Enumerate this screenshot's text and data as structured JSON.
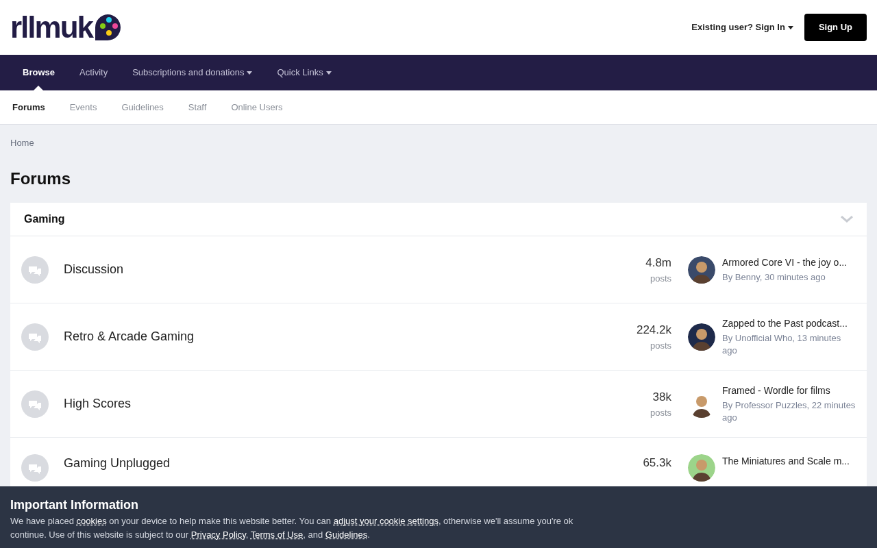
{
  "header": {
    "logo": "rllmuk",
    "sign_in": "Existing user? Sign In",
    "sign_up": "Sign Up"
  },
  "nav": [
    {
      "label": "Browse",
      "selected": true,
      "dropdown": false
    },
    {
      "label": "Activity",
      "selected": false,
      "dropdown": false
    },
    {
      "label": "Subscriptions and donations",
      "selected": false,
      "dropdown": true
    },
    {
      "label": "Quick Links",
      "selected": false,
      "dropdown": true
    }
  ],
  "subnav": [
    {
      "label": "Forums",
      "selected": true
    },
    {
      "label": "Events",
      "selected": false
    },
    {
      "label": "Guidelines",
      "selected": false
    },
    {
      "label": "Staff",
      "selected": false
    },
    {
      "label": "Online Users",
      "selected": false
    }
  ],
  "breadcrumb": "Home",
  "page_title": "Forums",
  "category": {
    "title": "Gaming",
    "expanded": true,
    "forums": [
      {
        "name": "Discussion",
        "count": "4.8m",
        "count_label": "posts",
        "last_title": "Armored Core VI - the joy o...",
        "last_meta": "By Benny, 30 minutes ago"
      },
      {
        "name": "Retro & Arcade Gaming",
        "count": "224.2k",
        "count_label": "posts",
        "last_title": "Zapped to the Past podcast...",
        "last_meta": "By Unofficial Who, 13 minutes ago"
      },
      {
        "name": "High Scores",
        "count": "38k",
        "count_label": "posts",
        "last_title": "Framed - Wordle for films",
        "last_meta": "By Professor Puzzles, 22 minutes ago"
      },
      {
        "name": "Gaming Unplugged",
        "count": "65.3k",
        "last_title": "The Miniatures and Scale m..."
      }
    ]
  },
  "cookie_banner": {
    "title": "Important Information",
    "lines": [
      [
        {
          "kind": "text",
          "text": "We have placed "
        },
        {
          "kind": "link",
          "text": "cookies"
        },
        {
          "kind": "text",
          "text": " on your device to help make this website better. You can "
        },
        {
          "kind": "link",
          "text": "adjust your cookie settings"
        },
        {
          "kind": "text",
          "text": ", otherwise we'll assume you're ok"
        }
      ],
      [
        {
          "kind": "text",
          "text": "continue. Use of this website is subject to our "
        },
        {
          "kind": "link",
          "text": "Privacy Policy"
        },
        {
          "kind": "text",
          "text": ", "
        },
        {
          "kind": "link",
          "text": "Terms of Use"
        },
        {
          "kind": "text",
          "text": ", and "
        },
        {
          "kind": "link",
          "text": "Guidelines"
        },
        {
          "kind": "text",
          "text": "."
        }
      ]
    ]
  }
}
